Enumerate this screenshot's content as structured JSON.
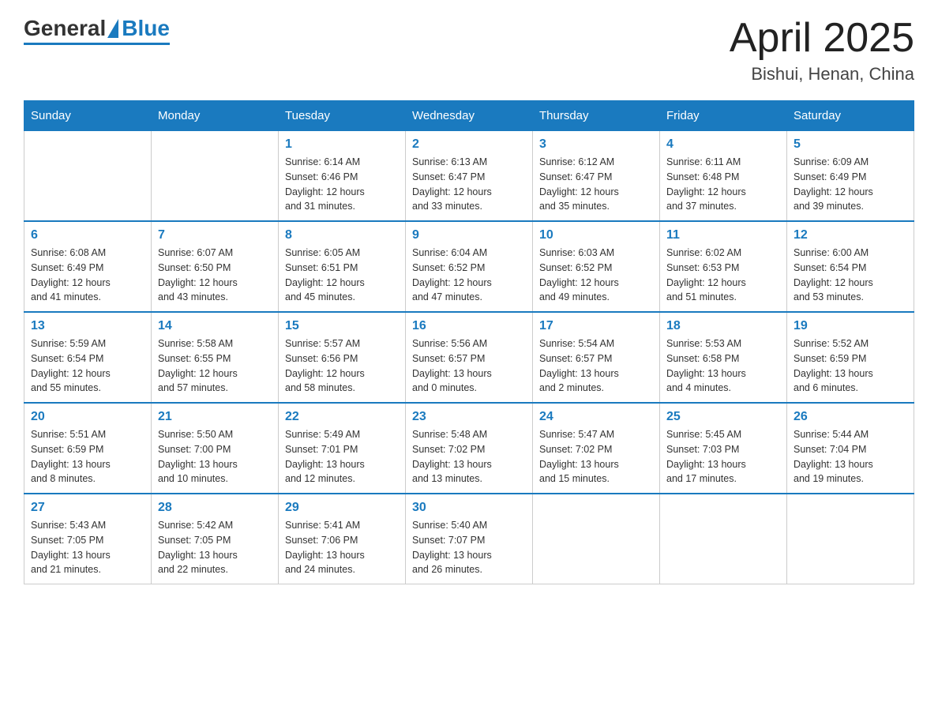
{
  "logo": {
    "text_general": "General",
    "text_blue": "Blue"
  },
  "title": {
    "month_year": "April 2025",
    "location": "Bishui, Henan, China"
  },
  "weekdays": [
    "Sunday",
    "Monday",
    "Tuesday",
    "Wednesday",
    "Thursday",
    "Friday",
    "Saturday"
  ],
  "weeks": [
    [
      {
        "day": "",
        "info": ""
      },
      {
        "day": "",
        "info": ""
      },
      {
        "day": "1",
        "info": "Sunrise: 6:14 AM\nSunset: 6:46 PM\nDaylight: 12 hours\nand 31 minutes."
      },
      {
        "day": "2",
        "info": "Sunrise: 6:13 AM\nSunset: 6:47 PM\nDaylight: 12 hours\nand 33 minutes."
      },
      {
        "day": "3",
        "info": "Sunrise: 6:12 AM\nSunset: 6:47 PM\nDaylight: 12 hours\nand 35 minutes."
      },
      {
        "day": "4",
        "info": "Sunrise: 6:11 AM\nSunset: 6:48 PM\nDaylight: 12 hours\nand 37 minutes."
      },
      {
        "day": "5",
        "info": "Sunrise: 6:09 AM\nSunset: 6:49 PM\nDaylight: 12 hours\nand 39 minutes."
      }
    ],
    [
      {
        "day": "6",
        "info": "Sunrise: 6:08 AM\nSunset: 6:49 PM\nDaylight: 12 hours\nand 41 minutes."
      },
      {
        "day": "7",
        "info": "Sunrise: 6:07 AM\nSunset: 6:50 PM\nDaylight: 12 hours\nand 43 minutes."
      },
      {
        "day": "8",
        "info": "Sunrise: 6:05 AM\nSunset: 6:51 PM\nDaylight: 12 hours\nand 45 minutes."
      },
      {
        "day": "9",
        "info": "Sunrise: 6:04 AM\nSunset: 6:52 PM\nDaylight: 12 hours\nand 47 minutes."
      },
      {
        "day": "10",
        "info": "Sunrise: 6:03 AM\nSunset: 6:52 PM\nDaylight: 12 hours\nand 49 minutes."
      },
      {
        "day": "11",
        "info": "Sunrise: 6:02 AM\nSunset: 6:53 PM\nDaylight: 12 hours\nand 51 minutes."
      },
      {
        "day": "12",
        "info": "Sunrise: 6:00 AM\nSunset: 6:54 PM\nDaylight: 12 hours\nand 53 minutes."
      }
    ],
    [
      {
        "day": "13",
        "info": "Sunrise: 5:59 AM\nSunset: 6:54 PM\nDaylight: 12 hours\nand 55 minutes."
      },
      {
        "day": "14",
        "info": "Sunrise: 5:58 AM\nSunset: 6:55 PM\nDaylight: 12 hours\nand 57 minutes."
      },
      {
        "day": "15",
        "info": "Sunrise: 5:57 AM\nSunset: 6:56 PM\nDaylight: 12 hours\nand 58 minutes."
      },
      {
        "day": "16",
        "info": "Sunrise: 5:56 AM\nSunset: 6:57 PM\nDaylight: 13 hours\nand 0 minutes."
      },
      {
        "day": "17",
        "info": "Sunrise: 5:54 AM\nSunset: 6:57 PM\nDaylight: 13 hours\nand 2 minutes."
      },
      {
        "day": "18",
        "info": "Sunrise: 5:53 AM\nSunset: 6:58 PM\nDaylight: 13 hours\nand 4 minutes."
      },
      {
        "day": "19",
        "info": "Sunrise: 5:52 AM\nSunset: 6:59 PM\nDaylight: 13 hours\nand 6 minutes."
      }
    ],
    [
      {
        "day": "20",
        "info": "Sunrise: 5:51 AM\nSunset: 6:59 PM\nDaylight: 13 hours\nand 8 minutes."
      },
      {
        "day": "21",
        "info": "Sunrise: 5:50 AM\nSunset: 7:00 PM\nDaylight: 13 hours\nand 10 minutes."
      },
      {
        "day": "22",
        "info": "Sunrise: 5:49 AM\nSunset: 7:01 PM\nDaylight: 13 hours\nand 12 minutes."
      },
      {
        "day": "23",
        "info": "Sunrise: 5:48 AM\nSunset: 7:02 PM\nDaylight: 13 hours\nand 13 minutes."
      },
      {
        "day": "24",
        "info": "Sunrise: 5:47 AM\nSunset: 7:02 PM\nDaylight: 13 hours\nand 15 minutes."
      },
      {
        "day": "25",
        "info": "Sunrise: 5:45 AM\nSunset: 7:03 PM\nDaylight: 13 hours\nand 17 minutes."
      },
      {
        "day": "26",
        "info": "Sunrise: 5:44 AM\nSunset: 7:04 PM\nDaylight: 13 hours\nand 19 minutes."
      }
    ],
    [
      {
        "day": "27",
        "info": "Sunrise: 5:43 AM\nSunset: 7:05 PM\nDaylight: 13 hours\nand 21 minutes."
      },
      {
        "day": "28",
        "info": "Sunrise: 5:42 AM\nSunset: 7:05 PM\nDaylight: 13 hours\nand 22 minutes."
      },
      {
        "day": "29",
        "info": "Sunrise: 5:41 AM\nSunset: 7:06 PM\nDaylight: 13 hours\nand 24 minutes."
      },
      {
        "day": "30",
        "info": "Sunrise: 5:40 AM\nSunset: 7:07 PM\nDaylight: 13 hours\nand 26 minutes."
      },
      {
        "day": "",
        "info": ""
      },
      {
        "day": "",
        "info": ""
      },
      {
        "day": "",
        "info": ""
      }
    ]
  ]
}
